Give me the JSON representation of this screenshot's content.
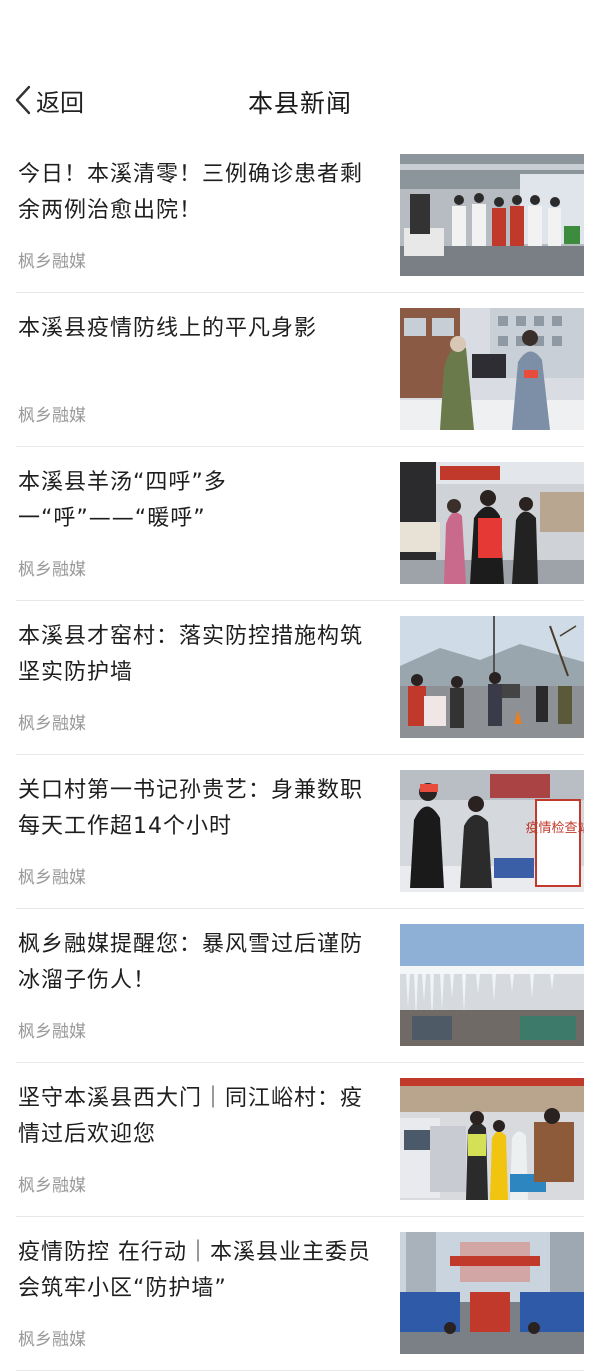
{
  "header": {
    "back_label": "返回",
    "title": "本县新闻"
  },
  "news": [
    {
      "title": "今日！本溪清零！三例确诊患者剩余两例治愈出院！",
      "source": "枫乡融媒",
      "thumb": "hospital-staff-photo"
    },
    {
      "title": "本溪县疫情防线上的平凡身影",
      "source": "枫乡融媒",
      "thumb": "checkpoint-volunteers-photo"
    },
    {
      "title": "本溪县羊汤“四呼”多一“呼”——“暖呼”",
      "source": "枫乡融媒",
      "thumb": "soup-delivery-photo"
    },
    {
      "title": "本溪县才窑村：落实防控措施构筑坚实防护墙",
      "source": "枫乡融媒",
      "thumb": "village-road-checkpoint-photo"
    },
    {
      "title": "关口村第一书记孙贵艺：身兼数职 每天工作超14个小时",
      "source": "枫乡融媒",
      "thumb": "epidemic-check-station-photo"
    },
    {
      "title": "枫乡融媒提醒您：暴风雪过后谨防冰溜子伤人！",
      "source": "枫乡融媒",
      "thumb": "icicles-roof-photo"
    },
    {
      "title": "坚守本溪县西大门｜同江峪村：疫情过后欢迎您",
      "source": "枫乡融媒",
      "thumb": "highway-checkpoint-photo"
    },
    {
      "title": "疫情防控 在行动｜本溪县业主委员会筑牢小区“防护墙”",
      "source": "枫乡融媒",
      "thumb": "residential-gate-photo"
    }
  ],
  "thumb_texts": {
    "station_sign": "疫情检查站"
  },
  "colors": {
    "text": "#1e1e1e",
    "source": "#9a9a9a",
    "divider": "#e8e8e8"
  }
}
